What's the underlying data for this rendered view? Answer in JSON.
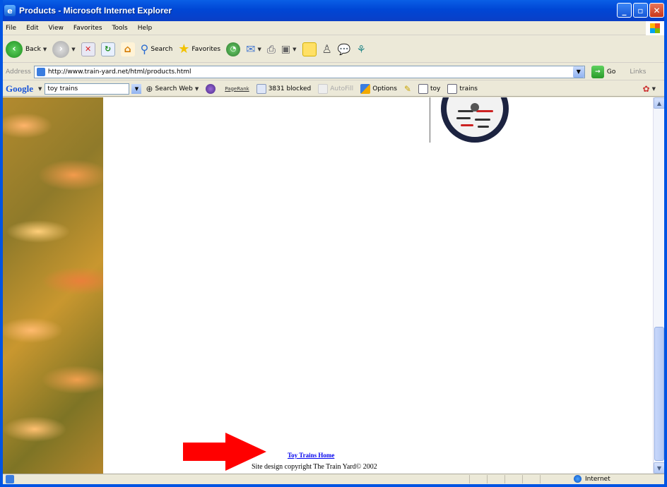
{
  "window": {
    "title": "Products - Microsoft Internet Explorer"
  },
  "menu": [
    "File",
    "Edit",
    "View",
    "Favorites",
    "Tools",
    "Help"
  ],
  "toolbar": {
    "back_label": "Back",
    "search_label": "Search",
    "favorites_label": "Favorites"
  },
  "address": {
    "label": "Address",
    "url": "http://www.train-yard.net/html/products.html",
    "go_label": "Go",
    "links_label": "Links"
  },
  "google_toolbar": {
    "logo": "Google",
    "query": "toy trains",
    "search_web_label": "Search Web",
    "pagerank_label": "PageRank",
    "blocked_label": "3831 blocked",
    "autofill_label": "AutoFill",
    "options_label": "Options",
    "term1": "toy",
    "term2": "trains"
  },
  "page": {
    "home_link": "Toy Trains Home",
    "copyright": "Site design copyright The Train Yard© 2002"
  },
  "status": {
    "zone": "Internet"
  },
  "colors": {
    "titlebar": "#0046d5",
    "link": "#0000ee",
    "arrow": "#ff0000"
  }
}
